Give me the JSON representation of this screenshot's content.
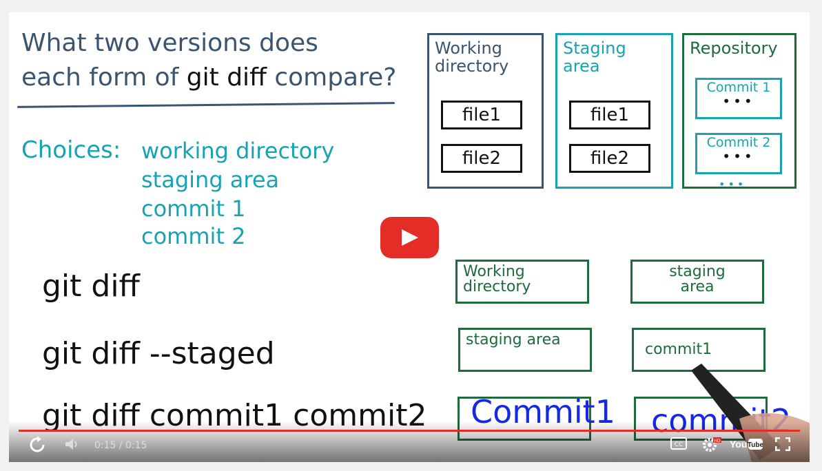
{
  "slide": {
    "question_line1": "What two versions does",
    "question_line2_pre": "each form of ",
    "question_line2_cmd": "git diff",
    "question_line2_post": " compare?",
    "choices_label": "Choices:",
    "choices": [
      "working directory",
      "staging area",
      "commit 1",
      "commit 2"
    ],
    "commands": [
      "git diff",
      "git diff --staged",
      "git diff commit1 commit2"
    ],
    "areas": {
      "working_directory": {
        "title": "Working\ndirectory",
        "files": [
          "file1",
          "file2"
        ]
      },
      "staging_area": {
        "title": "Staging\narea",
        "files": [
          "file1",
          "file2"
        ]
      },
      "repository": {
        "title": "Repository",
        "commits": [
          {
            "label": "Commit 1",
            "dots": "•••"
          },
          {
            "label": "Commit 2",
            "dots": "•••"
          }
        ],
        "more": "•••"
      }
    },
    "answers": [
      {
        "left": "Working\ndirectory",
        "right": "staging\narea"
      },
      {
        "left": "staging area",
        "right": "commit1"
      },
      {
        "left": "",
        "right": ""
      }
    ],
    "handwriting": {
      "left": "Commit1",
      "right": "commit2"
    }
  },
  "player": {
    "time_text": "0:15 / 0:15",
    "progress": 1.0,
    "colors": {
      "accent": "#e52d27"
    },
    "icons": [
      "replay-icon",
      "volume-icon",
      "cc-icon",
      "settings-hd-icon",
      "youtube-logo-icon",
      "fullscreen-icon"
    ]
  }
}
